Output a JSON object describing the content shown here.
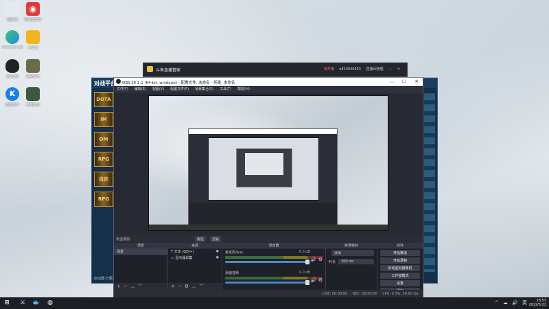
{
  "desktop": {
    "icons": [
      {
        "label": "回收站",
        "color": "#dfe7ee"
      },
      {
        "label": "网易云音乐",
        "color": "#e23a3a"
      },
      {
        "label": "Microsoft Edge",
        "color": "#1f8fe0"
      },
      {
        "label": "小红书",
        "color": "#f2b51f"
      },
      {
        "label": "腾讯QQ",
        "color": "#222222"
      },
      {
        "label": "战舰世界",
        "color": "#6b6b4a"
      },
      {
        "label": "酷狗音乐",
        "color": "#1a7ee8"
      },
      {
        "label": "英雄联盟",
        "color": "#3b5a3b"
      }
    ]
  },
  "popup": {
    "title": "斗鱼直播管家",
    "live_status": "未开播",
    "user": "a824846653",
    "action": "直播间管理"
  },
  "launcher": {
    "brand": "对战平台",
    "tiles": [
      "DOTA",
      "IM",
      "OM",
      "RPG",
      "自走",
      "RPG"
    ],
    "footer_left": "启动器·已更新"
  },
  "obs": {
    "title": "OBS 26.1.1 (64-bit, windows) - 配置文件: 未命名 - 场景: 未命名",
    "menu": [
      "文件(F)",
      "编辑(E)",
      "视图(V)",
      "配置文件(P)",
      "场景集合(S)",
      "工具(T)",
      "帮助(H)"
    ],
    "window_buttons": [
      "—",
      "☐",
      "✕"
    ],
    "scene_strip": {
      "label": "未选择源",
      "properties": "属性",
      "filters": "滤镜"
    },
    "docks": {
      "scenes": {
        "header": "场景",
        "items": [
          "场景"
        ]
      },
      "sources": {
        "header": "来源",
        "items": [
          {
            "icon": "T",
            "name": "文本 (GDI+)"
          },
          {
            "icon": "▭",
            "name": "显示器采集"
          }
        ]
      },
      "mixer": {
        "header": "混音器",
        "channels": [
          {
            "name": "麦克风/Aux",
            "db": "0.0 dB"
          },
          {
            "name": "桌面音频",
            "db": "0.0 dB"
          }
        ]
      },
      "transitions": {
        "header": "转场特效",
        "type": "淡出",
        "duration_label": "时长",
        "duration_value": "300 ms"
      },
      "controls": {
        "header": "控件",
        "buttons": [
          "开始推流",
          "开始录制",
          "启动虚拟摄像机",
          "工作室模式",
          "设置",
          "退出"
        ]
      }
    },
    "status": {
      "live": "LIVE: 00:00:00",
      "rec": "REC: 00:00:00",
      "cpu": "CPU: 0.3%, 30.00 fps"
    }
  },
  "taskbar": {
    "tray_icons": [
      "^",
      "☁",
      "🔊",
      "英"
    ],
    "time": "18:53",
    "date": "2022/5/22"
  }
}
